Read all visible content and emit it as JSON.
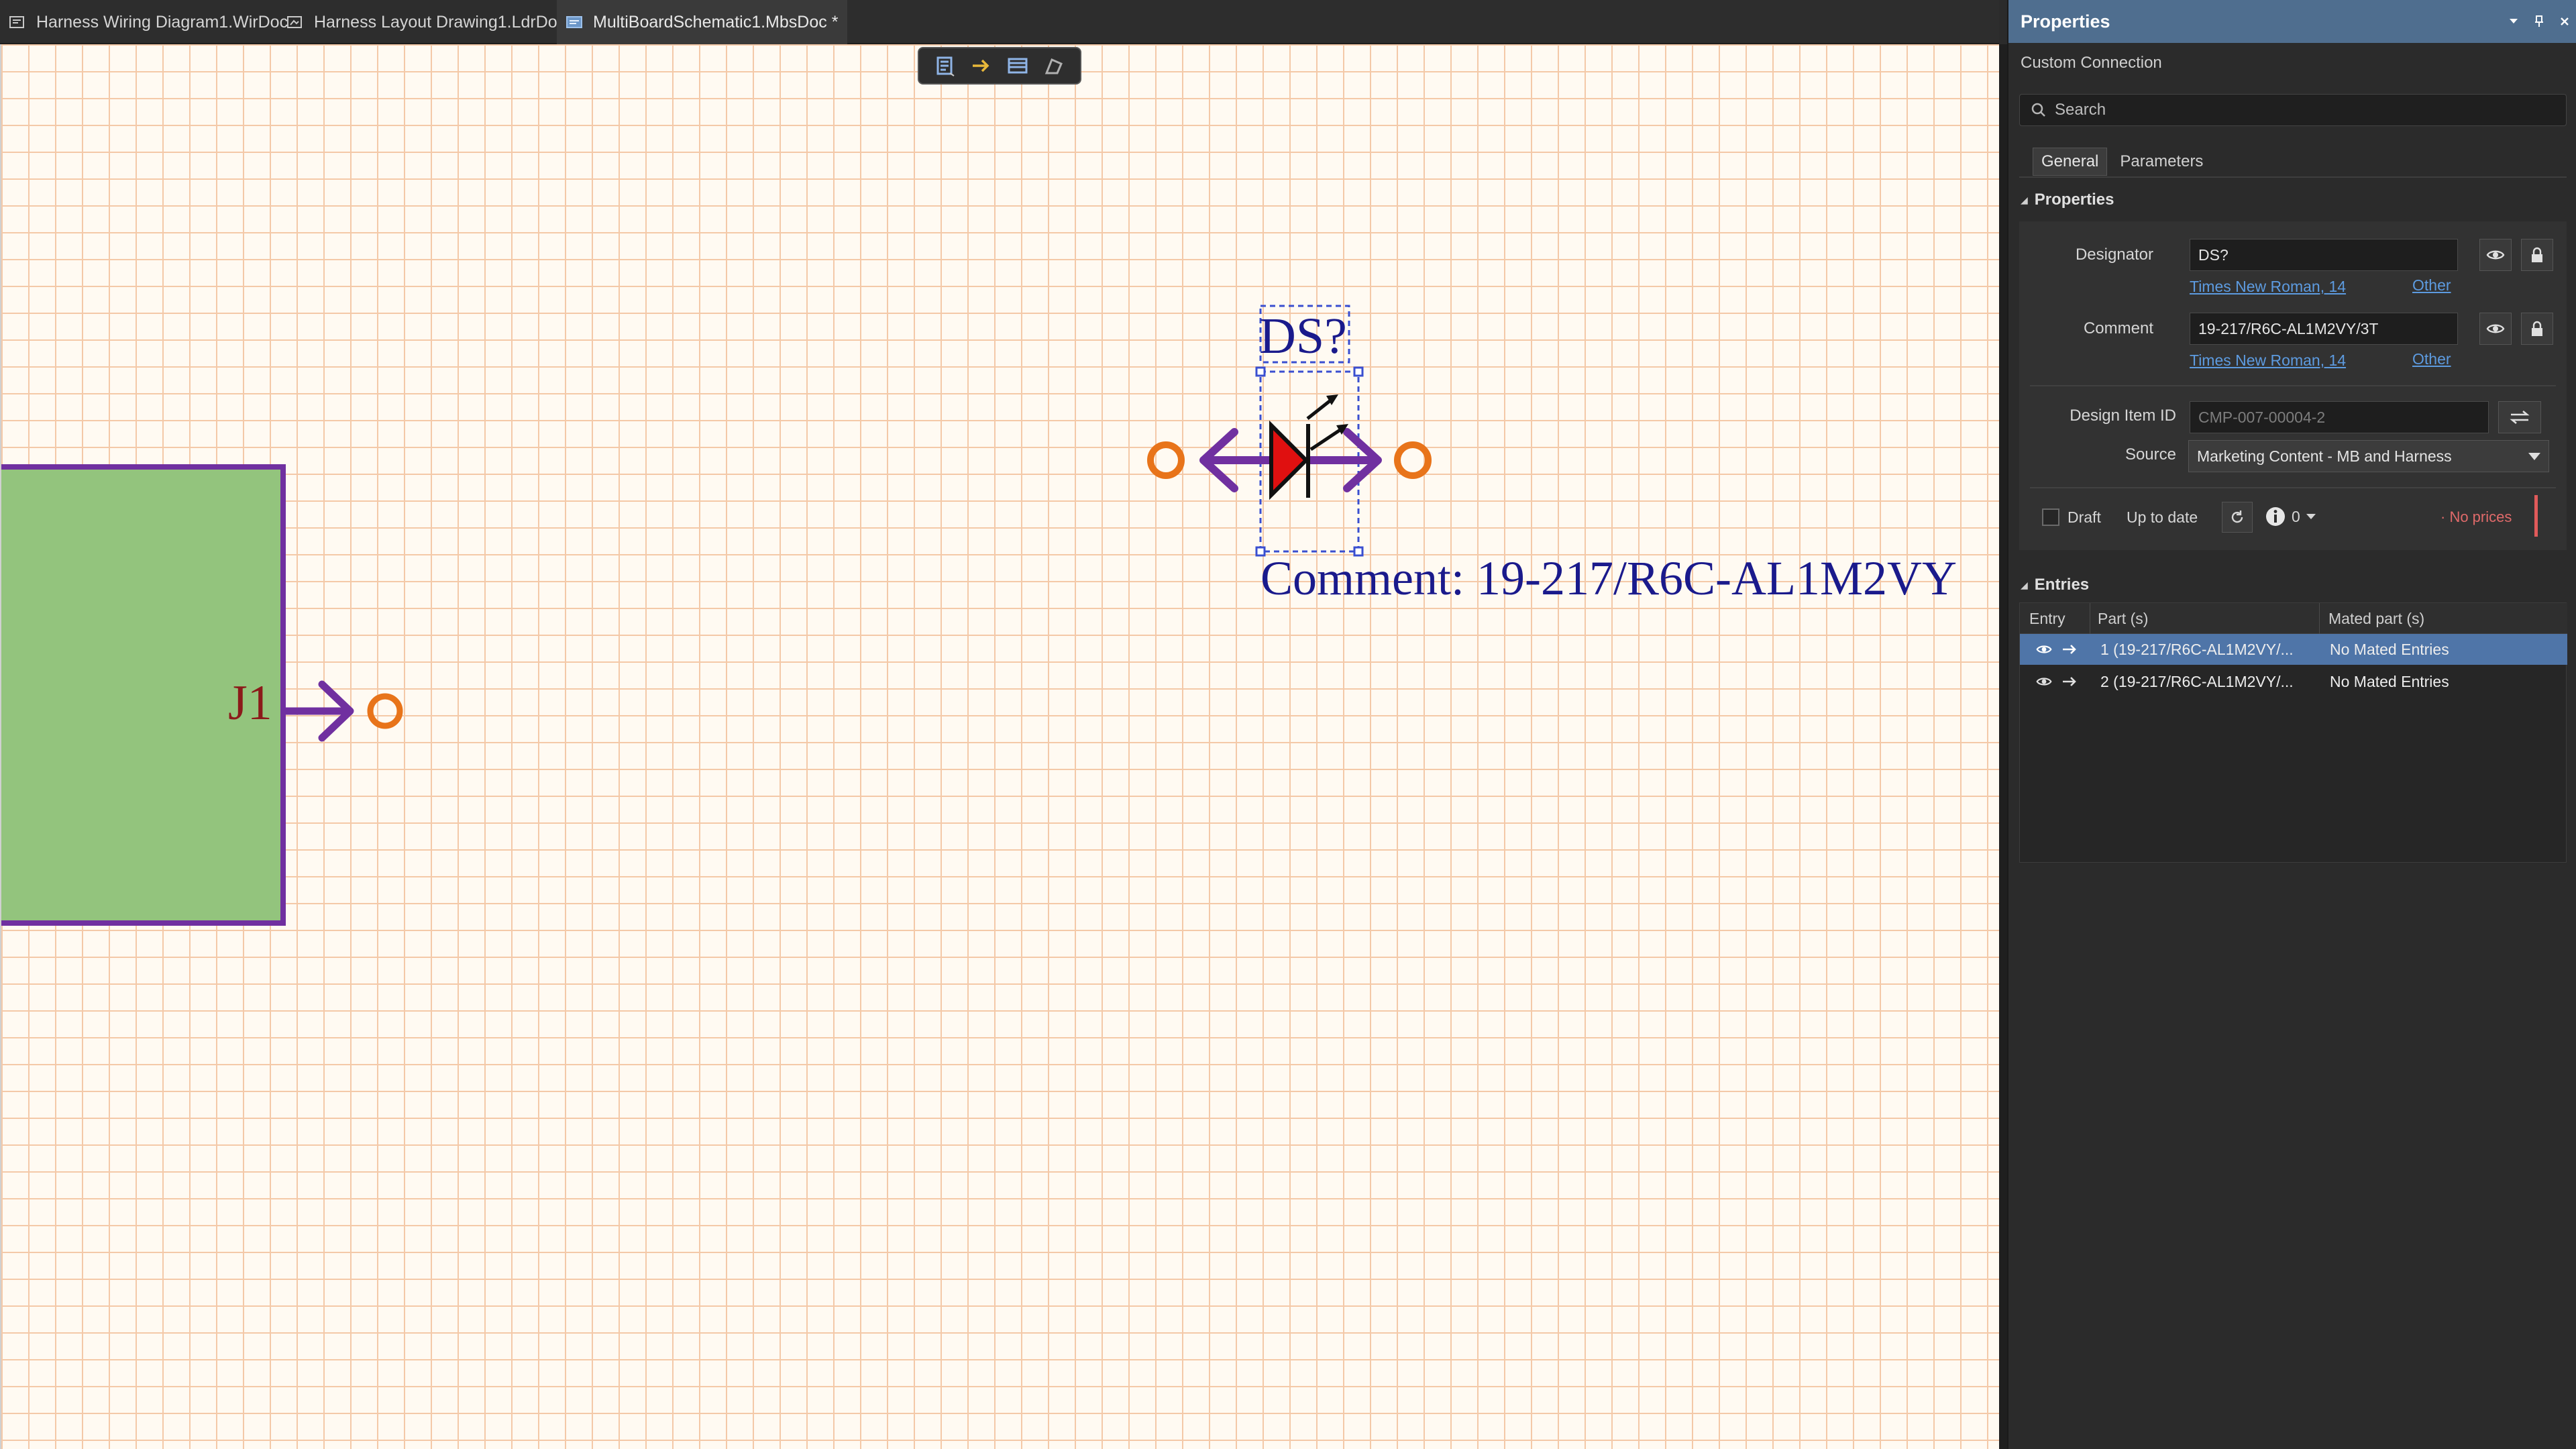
{
  "tabs": [
    {
      "label": "Harness Wiring Diagram1.WirDoc",
      "active": false
    },
    {
      "label": "Harness Layout Drawing1.LdrDoc",
      "active": false
    },
    {
      "label": "MultiBoardSchematic1.MbsDoc *",
      "active": true
    }
  ],
  "canvas": {
    "connector_label": "J1",
    "designator_text": "DS?",
    "comment_text": "Comment: 19-217/R6C-AL1M2VY"
  },
  "panel": {
    "title": "Properties",
    "object_type": "Custom Connection",
    "search_placeholder": "Search",
    "tabs": [
      "General",
      "Parameters"
    ],
    "active_tab": "General",
    "properties_section": "Properties",
    "designator_label": "Designator",
    "designator_value": "DS?",
    "designator_font": "Times New Roman, 14",
    "comment_label": "Comment",
    "comment_value": "19-217/R6C-AL1M2VY/3T",
    "comment_font": "Times New Roman, 14",
    "other_label": "Other",
    "design_item_label": "Design Item ID",
    "design_item_value": "CMP-007-00004-2",
    "source_label": "Source",
    "source_value": "Marketing Content - MB and Harness",
    "draft_label": "Draft",
    "status_text": "Up to date",
    "issues_count": "0",
    "prices_text": "· No prices",
    "entries_section": "Entries",
    "entries_columns": [
      "Entry",
      "Part (s)",
      "Mated part (s)"
    ],
    "entries": [
      {
        "part": "1 (19-217/R6C-AL1M2VY/...",
        "mated": "No Mated Entries"
      },
      {
        "part": "2 (19-217/R6C-AL1M2VY/...",
        "mated": "No Mated Entries"
      }
    ]
  },
  "colors": {
    "accent": "#4f6e8f",
    "selection": "#4f75a8",
    "grid": "#f4c9a8",
    "wire": "#7030a0",
    "pin": "#e8741a",
    "schematic_text": "#1a1a8c",
    "connector_fill": "#93c47d",
    "link": "#5d9be0",
    "warning": "#e06a6a"
  }
}
